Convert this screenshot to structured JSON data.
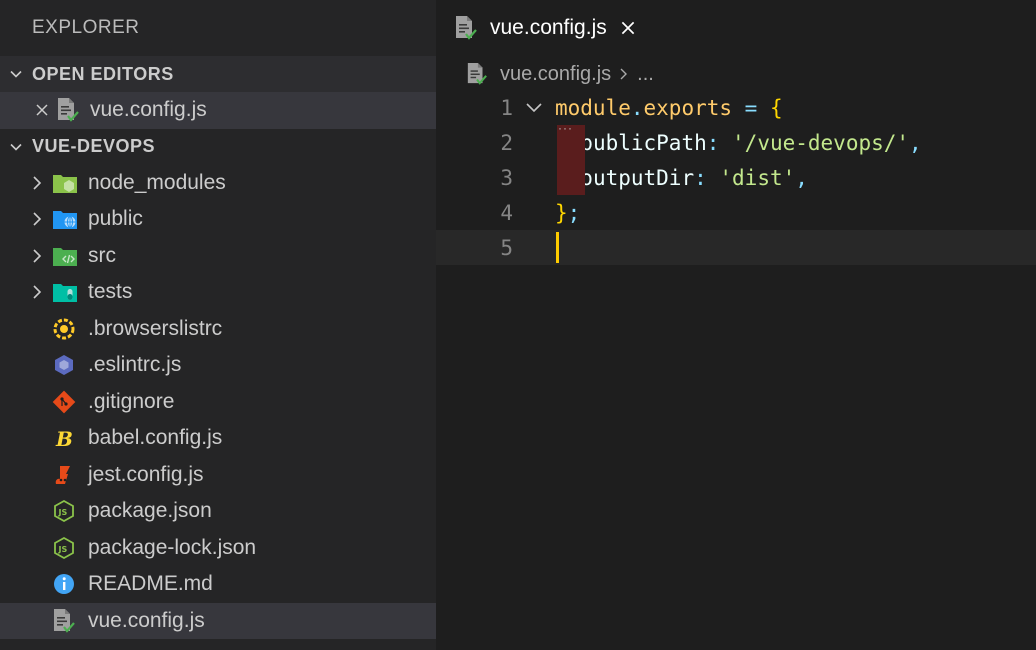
{
  "explorer": {
    "title": "EXPLORER",
    "open_editors": {
      "label": "OPEN EDITORS",
      "items": [
        {
          "label": "vue.config.js",
          "icon": "js-file-icon"
        }
      ]
    },
    "project": {
      "label": "VUE-DEVOPS",
      "items": [
        {
          "label": "node_modules",
          "type": "folder",
          "icon": "node-modules-folder-icon",
          "color": "#8bc34a"
        },
        {
          "label": "public",
          "type": "folder",
          "icon": "public-folder-icon",
          "color": "#2196f3"
        },
        {
          "label": "src",
          "type": "folder",
          "icon": "src-folder-icon",
          "color": "#4caf50"
        },
        {
          "label": "tests",
          "type": "folder",
          "icon": "tests-folder-icon",
          "color": "#00bfa5"
        },
        {
          "label": ".browserslistrc",
          "type": "file",
          "icon": "browserslist-icon",
          "color": "#ffca28"
        },
        {
          "label": ".eslintrc.js",
          "type": "file",
          "icon": "eslint-icon",
          "color": "#5c6bc0"
        },
        {
          "label": ".gitignore",
          "type": "file",
          "icon": "git-icon",
          "color": "#e64a19"
        },
        {
          "label": "babel.config.js",
          "type": "file",
          "icon": "babel-icon",
          "color": "#fdd835"
        },
        {
          "label": "jest.config.js",
          "type": "file",
          "icon": "jest-icon",
          "color": "#e64a19"
        },
        {
          "label": "package.json",
          "type": "file",
          "icon": "nodejs-icon",
          "color": "#8bc34a"
        },
        {
          "label": "package-lock.json",
          "type": "file",
          "icon": "nodejs-icon",
          "color": "#8bc34a"
        },
        {
          "label": "README.md",
          "type": "file",
          "icon": "info-icon",
          "color": "#42a5f5"
        },
        {
          "label": "vue.config.js",
          "type": "file",
          "icon": "js-file-icon",
          "color": "#a0a0a0",
          "selected": true
        }
      ]
    }
  },
  "editor": {
    "tab": {
      "label": "vue.config.js",
      "icon": "js-file-icon"
    },
    "breadcrumb": {
      "file": "vue.config.js",
      "more": "..."
    },
    "code": {
      "line1": {
        "num": "1",
        "mod": "module",
        "dot": ".",
        "exp": "exports",
        "eq": " = ",
        "brace": "{"
      },
      "line2": {
        "num": "2",
        "key": "publicPath",
        "colon": ": ",
        "str": "'/vue-devops/'",
        "comma": ","
      },
      "line3": {
        "num": "3",
        "key": "outputDir",
        "colon": ": ",
        "str": "'dist'",
        "comma": ","
      },
      "line4": {
        "num": "4",
        "brace": "}",
        "semi": ";"
      },
      "line5": {
        "num": "5"
      }
    },
    "fold_dots": "···"
  }
}
